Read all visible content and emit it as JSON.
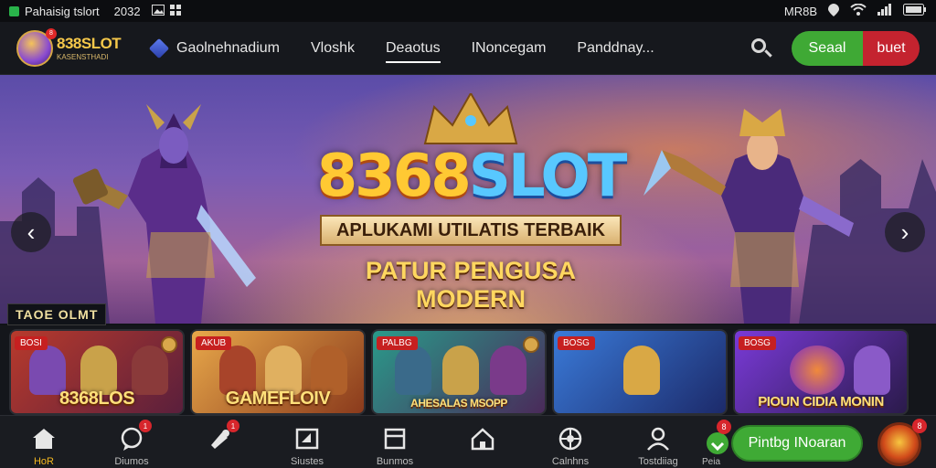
{
  "status_bar": {
    "app_name": "Pahaisig tslort",
    "time": "2032",
    "right_text": "MR8B"
  },
  "header": {
    "logo_text": "838SLOT",
    "logo_subtitle": "KASENSTHADI",
    "logo_badge": "8",
    "nav": [
      {
        "label": "Gaolnehnadium",
        "icon": "cube-icon"
      },
      {
        "label": "Vloshk"
      },
      {
        "label": "Deaotus",
        "active": true
      },
      {
        "label": "INoncegam"
      },
      {
        "label": "Panddnay..."
      }
    ],
    "login_label": "Seaal",
    "register_label": "buet"
  },
  "hero": {
    "title_part1": "8368",
    "title_part2": "SLOT",
    "ribbon": "APLUKAMI UTILATIS TERBAIK",
    "tagline": "PATUR PENGUSA MODERN",
    "prev_glyph": "‹",
    "next_glyph": "›"
  },
  "games": {
    "section_label": "TAOE OLMT",
    "cards": [
      {
        "tag": "BOSI",
        "title": "8368LOS",
        "colors": [
          "#b83a2c",
          "#5a1f3c"
        ]
      },
      {
        "tag": "AKUB",
        "title": "GAMEFLOIV",
        "colors": [
          "#e8a84a",
          "#8a3a1c"
        ]
      },
      {
        "tag": "PALBG",
        "title": "AHESALAS MSOPP",
        "colors": [
          "#2a9a8a",
          "#4a2a5a"
        ]
      },
      {
        "tag": "BOSG",
        "title": "",
        "colors": [
          "#3a7ad8",
          "#1c2a6a"
        ]
      },
      {
        "tag": "BOSG",
        "title": "PIOUN CIDIA MONIN",
        "colors": [
          "#7a3ad8",
          "#2a1a4a"
        ]
      }
    ]
  },
  "bottom_nav": {
    "items": [
      {
        "label": "HoR",
        "icon": "home-icon",
        "active": true
      },
      {
        "label": "Diumos",
        "icon": "chat-icon",
        "badge": "1"
      },
      {
        "label": "",
        "icon": "promo-icon",
        "badge": "1"
      },
      {
        "label": "Siustes",
        "icon": "wallet-icon"
      },
      {
        "label": "Bunmos",
        "icon": "box-icon"
      },
      {
        "label": "",
        "icon": "house-icon"
      },
      {
        "label": "Calnhns",
        "icon": "sport-icon"
      },
      {
        "label": "Tostdiiag",
        "icon": "user-icon"
      }
    ],
    "cta_label": "Pintbg INoaran",
    "cta_badge": "8",
    "cta_icon_label": "Peia",
    "avatar_badge": "8"
  },
  "colors": {
    "accent_green": "#3fa935",
    "accent_red": "#c4232f",
    "gold": "#ffc933",
    "blue": "#58c8ff"
  }
}
